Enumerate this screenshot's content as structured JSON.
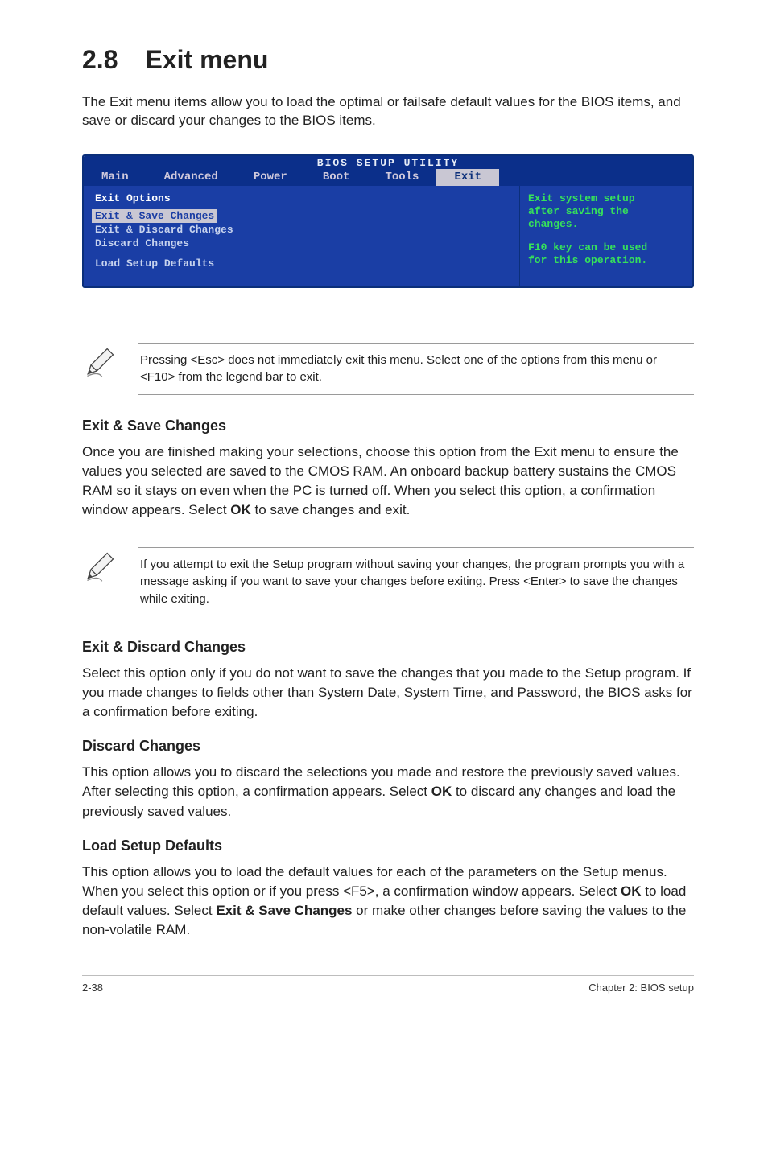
{
  "title": {
    "num": "2.8",
    "text": "Exit menu"
  },
  "intro": "The Exit menu items allow you to load the optimal or failsafe default values for the BIOS items, and save or discard your changes to the BIOS items.",
  "bios": {
    "title": "BIOS SETUP UTILITY",
    "tabs": [
      "Main",
      "Advanced",
      "Power",
      "Boot",
      "Tools",
      "Exit"
    ],
    "active_tab": "Exit",
    "left_heading": "Exit Options",
    "left_items": [
      {
        "label": "Exit & Save Changes",
        "selected": true
      },
      {
        "label": "Exit & Discard Changes",
        "selected": false
      },
      {
        "label": "Discard Changes",
        "selected": false
      }
    ],
    "left_item_after_gap": "Load Setup Defaults",
    "right_lines": [
      "Exit system setup",
      "after saving the",
      "changes.",
      "",
      "F10 key can be used",
      "for this operation."
    ]
  },
  "note1": "Pressing <Esc> does not immediately exit this menu. Select one of the options from this menu or <F10> from the legend bar to exit.",
  "sections": {
    "s1": {
      "h": "Exit & Save Changes",
      "p_parts": [
        "Once you are finished making your selections, choose this option from the Exit menu to ensure the values you selected are saved to the CMOS RAM. An onboard backup battery sustains the CMOS RAM so it stays on even when the PC is turned off. When you select this option, a confirmation window appears. Select ",
        "OK",
        " to save changes and exit."
      ]
    },
    "note2": " If you attempt to exit the Setup program without saving your changes, the program prompts you with a message asking if you want to save your changes before exiting. Press <Enter>  to save the  changes while exiting.",
    "s2": {
      "h": "Exit & Discard Changes",
      "p": "Select this option only if you do not want to save the changes that you  made to the Setup program. If you made changes to fields other than System Date, System Time, and Password, the BIOS asks for a confirmation before exiting."
    },
    "s3": {
      "h": "Discard Changes",
      "p_parts": [
        "This option allows you to discard the selections you made and restore the previously saved values. After selecting this option, a confirmation appears. Select ",
        "OK",
        " to discard any changes and load the previously saved values."
      ]
    },
    "s4": {
      "h": "Load Setup Defaults",
      "p_parts": [
        "This option allows you to load the default values for each of the parameters on the Setup menus. When you select this option or if you press <F5>, a confirmation window appears. Select ",
        "OK",
        " to load default values. Select ",
        "Exit & Save Changes",
        " or make other changes before saving the values to the non-volatile RAM."
      ]
    }
  },
  "footer": {
    "left": "2-38",
    "right": "Chapter 2: BIOS setup"
  },
  "icons": {
    "pencil": "pencil-icon"
  }
}
